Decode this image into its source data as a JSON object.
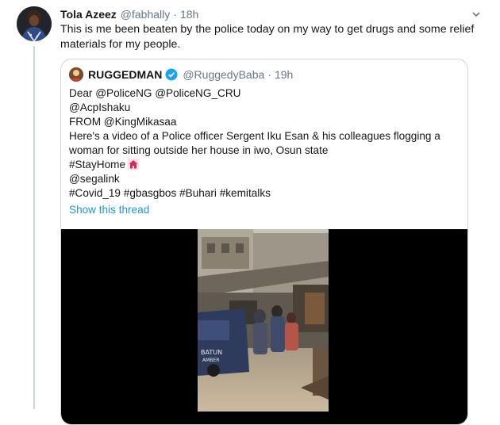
{
  "tweet": {
    "name": "Tola Azeez",
    "handle": "@fabhally",
    "separator": "·",
    "time": "18h",
    "text": "This is me been beaten by the police today on my way to get drugs and some relief materials for my people."
  },
  "quoted": {
    "name": "RUGGEDMAN",
    "handle": "@RuggedyBaba",
    "separator": "·",
    "time": "19h",
    "lines": [
      "Dear @PoliceNG @PoliceNG_CRU",
      "@AcpIshaku",
      "FROM @KingMikasaa",
      "Here's a video of a Police officer  Sergent Iku Esan & his colleagues flogging a",
      "woman for sitting outside her house in iwo, Osun state",
      "#StayHome",
      "@segalink",
      "#Covid_19 #gbasgbos #Buhari #kemitalks"
    ],
    "show_thread": "Show this thread",
    "video_watermark": "BATUN\nAMBER"
  },
  "icons": {
    "tweet_menu": "chevron-down-icon",
    "verified": "verified-badge-icon",
    "stayhome": "house-icon"
  },
  "colors": {
    "link": "#1b95e0",
    "verified": "#1da1f2",
    "secondary_text": "#657786",
    "border": "#ccd6dd"
  }
}
